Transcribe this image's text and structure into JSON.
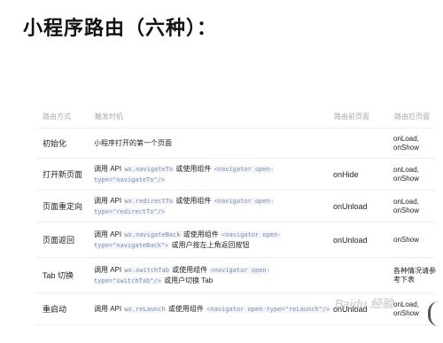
{
  "title": "小程序路由（六种）：",
  "table": {
    "headers": [
      "路由方式",
      "触发时机",
      "路由前页面",
      "路由后页面"
    ],
    "rows": [
      {
        "method": "初始化",
        "trigger_parts": [
          "小程序打开的第一个页面"
        ],
        "before": "",
        "after": "onLoad, onShow"
      },
      {
        "method": "打开新页面",
        "trigger_parts": [
          "调用 API ",
          "wx.navigateTo",
          " 或使用组件 ",
          "<navigator open-type=\"navigateTo\"/>"
        ],
        "before": "onHide",
        "after": "onLoad, onShow"
      },
      {
        "method": "页面重定向",
        "trigger_parts": [
          "调用 API ",
          "wx.redirectTo",
          " 或使用组件 ",
          "<navigator open-type=\"redirectTo\"/>"
        ],
        "before": "onUnload",
        "after": "onLoad, onShow"
      },
      {
        "method": "页面返回",
        "trigger_parts": [
          "调用 API ",
          "wx.navigateBack",
          " 或使用组件 ",
          "<navigator open-type=\"navigateBack\">",
          " 或用户按左上角返回按钮"
        ],
        "before": "onUnload",
        "after": "onShow"
      },
      {
        "method": "Tab 切换",
        "trigger_parts": [
          "调用 API ",
          "wx.switchTab",
          " 或使用组件 ",
          "<navigator open-type=\"switchTab\"/>",
          " 或用户切换 Tab"
        ],
        "before": "",
        "after": "各种情况请参考下表"
      },
      {
        "method": "重启动",
        "trigger_parts": [
          "调用 API ",
          "wx.reLaunch",
          " 或使用组件 ",
          "<navigator open-type=\"reLaunch\"/>"
        ],
        "before": "onUnload",
        "after": "onLoad, onShow"
      }
    ]
  },
  "watermark": "Baidu 经验"
}
